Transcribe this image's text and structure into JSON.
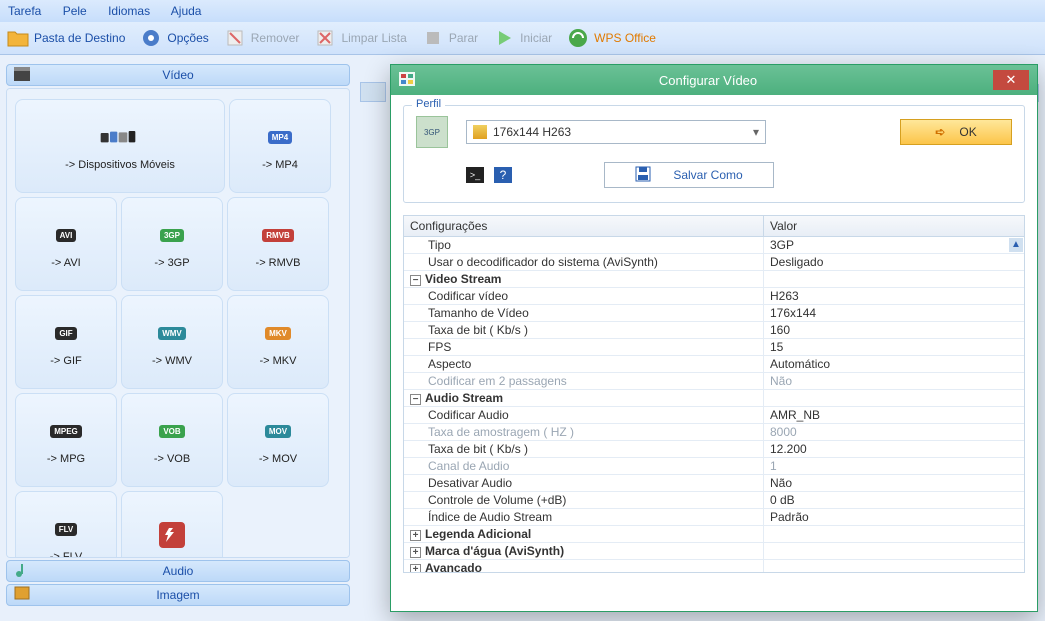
{
  "menu": {
    "items": [
      "Tarefa",
      "Pele",
      "Idiomas",
      "Ajuda"
    ]
  },
  "toolbar": {
    "pasta": "Pasta de Destino",
    "opcoes": "Opções",
    "remover": "Remover",
    "limpar": "Limpar Lista",
    "parar": "Parar",
    "iniciar": "Iniciar",
    "wps": "WPS Office"
  },
  "sections": {
    "video": "Vídeo",
    "audio": "Audio",
    "imagem": "Imagem"
  },
  "formats": [
    {
      "label": "-> Dispositivos Móveis",
      "wide": true,
      "badge": "",
      "cls": ""
    },
    {
      "label": "-> MP4",
      "badge": "MP4",
      "cls": "bg-blue"
    },
    {
      "label": "-> AVI",
      "badge": "AVI",
      "cls": "bg-dark"
    },
    {
      "label": "-> 3GP",
      "badge": "3GP",
      "cls": "bg-green"
    },
    {
      "label": "-> RMVB",
      "badge": "RMVB",
      "cls": "bg-red"
    },
    {
      "label": "-> GIF",
      "badge": "GIF",
      "cls": "bg-dark"
    },
    {
      "label": "-> WMV",
      "badge": "WMV",
      "cls": "bg-teal"
    },
    {
      "label": "-> MKV",
      "badge": "MKV",
      "cls": "bg-orange"
    },
    {
      "label": "-> MPG",
      "badge": "MPEG",
      "cls": "bg-dark"
    },
    {
      "label": "-> VOB",
      "badge": "VOB",
      "cls": "bg-green"
    },
    {
      "label": "-> MOV",
      "badge": "MOV",
      "cls": "bg-teal"
    },
    {
      "label": "-> FLV",
      "badge": "FLV",
      "cls": "bg-dark"
    },
    {
      "label": "",
      "badge": "",
      "cls": "bg-red"
    }
  ],
  "dialog": {
    "title": "Configurar Vídeo",
    "profile_legend": "Perfil",
    "profile_selected": "176x144 H263",
    "ok": "OK",
    "save_as": "Salvar Como",
    "col_config": "Configurações",
    "col_value": "Valor",
    "rows": [
      {
        "type": "row",
        "k": "Tipo",
        "v": "3GP"
      },
      {
        "type": "row",
        "k": "Usar o decodificador do sistema (AviSynth)",
        "v": "Desligado"
      },
      {
        "type": "group",
        "k": "Video Stream",
        "open": true
      },
      {
        "type": "row",
        "k": "Codificar vídeo",
        "v": "H263"
      },
      {
        "type": "row",
        "k": "Tamanho de Vídeo",
        "v": "176x144"
      },
      {
        "type": "row",
        "k": "Taxa de bit ( Kb/s )",
        "v": "160"
      },
      {
        "type": "row",
        "k": "FPS",
        "v": "15"
      },
      {
        "type": "row",
        "k": "Aspecto",
        "v": "Automático"
      },
      {
        "type": "row",
        "k": "Codificar em 2 passagens",
        "v": "Não",
        "disabled": true
      },
      {
        "type": "group",
        "k": "Audio Stream",
        "open": true
      },
      {
        "type": "row",
        "k": "Codificar Audio",
        "v": "AMR_NB"
      },
      {
        "type": "row",
        "k": "Taxa de amostragem ( HZ )",
        "v": "8000",
        "disabled": true
      },
      {
        "type": "row",
        "k": "Taxa de bit ( Kb/s )",
        "v": "12.200"
      },
      {
        "type": "row",
        "k": "Canal de Audio",
        "v": "1",
        "disabled": true
      },
      {
        "type": "row",
        "k": "Desativar Audio",
        "v": "Não"
      },
      {
        "type": "row",
        "k": "Controle de Volume (+dB)",
        "v": "0 dB"
      },
      {
        "type": "row",
        "k": "Índice de Audio Stream",
        "v": "Padrão"
      },
      {
        "type": "group",
        "k": "Legenda Adicional",
        "open": false
      },
      {
        "type": "group",
        "k": "Marca d'água (AviSynth)",
        "open": false
      },
      {
        "type": "group",
        "k": "Avançado",
        "open": false
      }
    ]
  }
}
